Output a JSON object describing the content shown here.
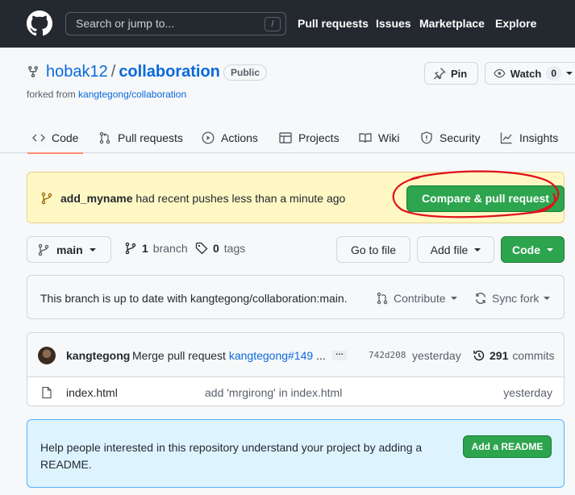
{
  "header": {
    "search_placeholder": "Search or jump to...",
    "search_key": "/",
    "nav": [
      "Pull requests",
      "Issues",
      "Marketplace",
      "Explore"
    ]
  },
  "repo": {
    "owner": "hobak12",
    "separator": "/",
    "name": "collaboration",
    "visibility": "Public",
    "forked_prefix": "forked from",
    "forked_from": "kangtegong/collaboration",
    "pin_label": "Pin",
    "watch_label": "Watch",
    "watch_count": "0"
  },
  "tabs": [
    {
      "label": "Code",
      "icon": "code-icon"
    },
    {
      "label": "Pull requests",
      "icon": "pull-request-icon"
    },
    {
      "label": "Actions",
      "icon": "play-icon"
    },
    {
      "label": "Projects",
      "icon": "table-icon"
    },
    {
      "label": "Wiki",
      "icon": "book-icon"
    },
    {
      "label": "Security",
      "icon": "shield-icon"
    },
    {
      "label": "Insights",
      "icon": "graph-icon"
    }
  ],
  "banner": {
    "branch": "add_myname",
    "message": "had recent pushes less than a minute ago",
    "button": "Compare & pull request"
  },
  "toolbar": {
    "branch_select": "main",
    "branch_count": "1",
    "branch_word": "branch",
    "tag_count": "0",
    "tag_word": "tags",
    "go_to_file": "Go to file",
    "add_file": "Add file",
    "code": "Code"
  },
  "status": {
    "text": "This branch is up to date with kangtegong/collaboration:main.",
    "contribute": "Contribute",
    "sync_fork": "Sync fork"
  },
  "commit": {
    "author": "kangtegong",
    "message": "Merge pull request",
    "link": "kangtegong#149",
    "truncation": "...",
    "ellipsis_button": "…",
    "sha": "742d208",
    "when": "yesterday",
    "count": "291",
    "count_word": "commits"
  },
  "files": [
    {
      "name": "index.html",
      "message": "add 'mrgirong' in index.html",
      "when": "yesterday"
    }
  ],
  "readme": {
    "text": "Help people interested in this repository understand your project by adding a README.",
    "button": "Add a README"
  },
  "colors": {
    "header_bg": "#24292f",
    "link": "#0969da",
    "primary_button": "#2da44e",
    "tab_underline": "#fd8c73",
    "banner_bg": "#fff8c5",
    "readme_bg": "#ddf4ff",
    "annotation": "#e0101a"
  }
}
